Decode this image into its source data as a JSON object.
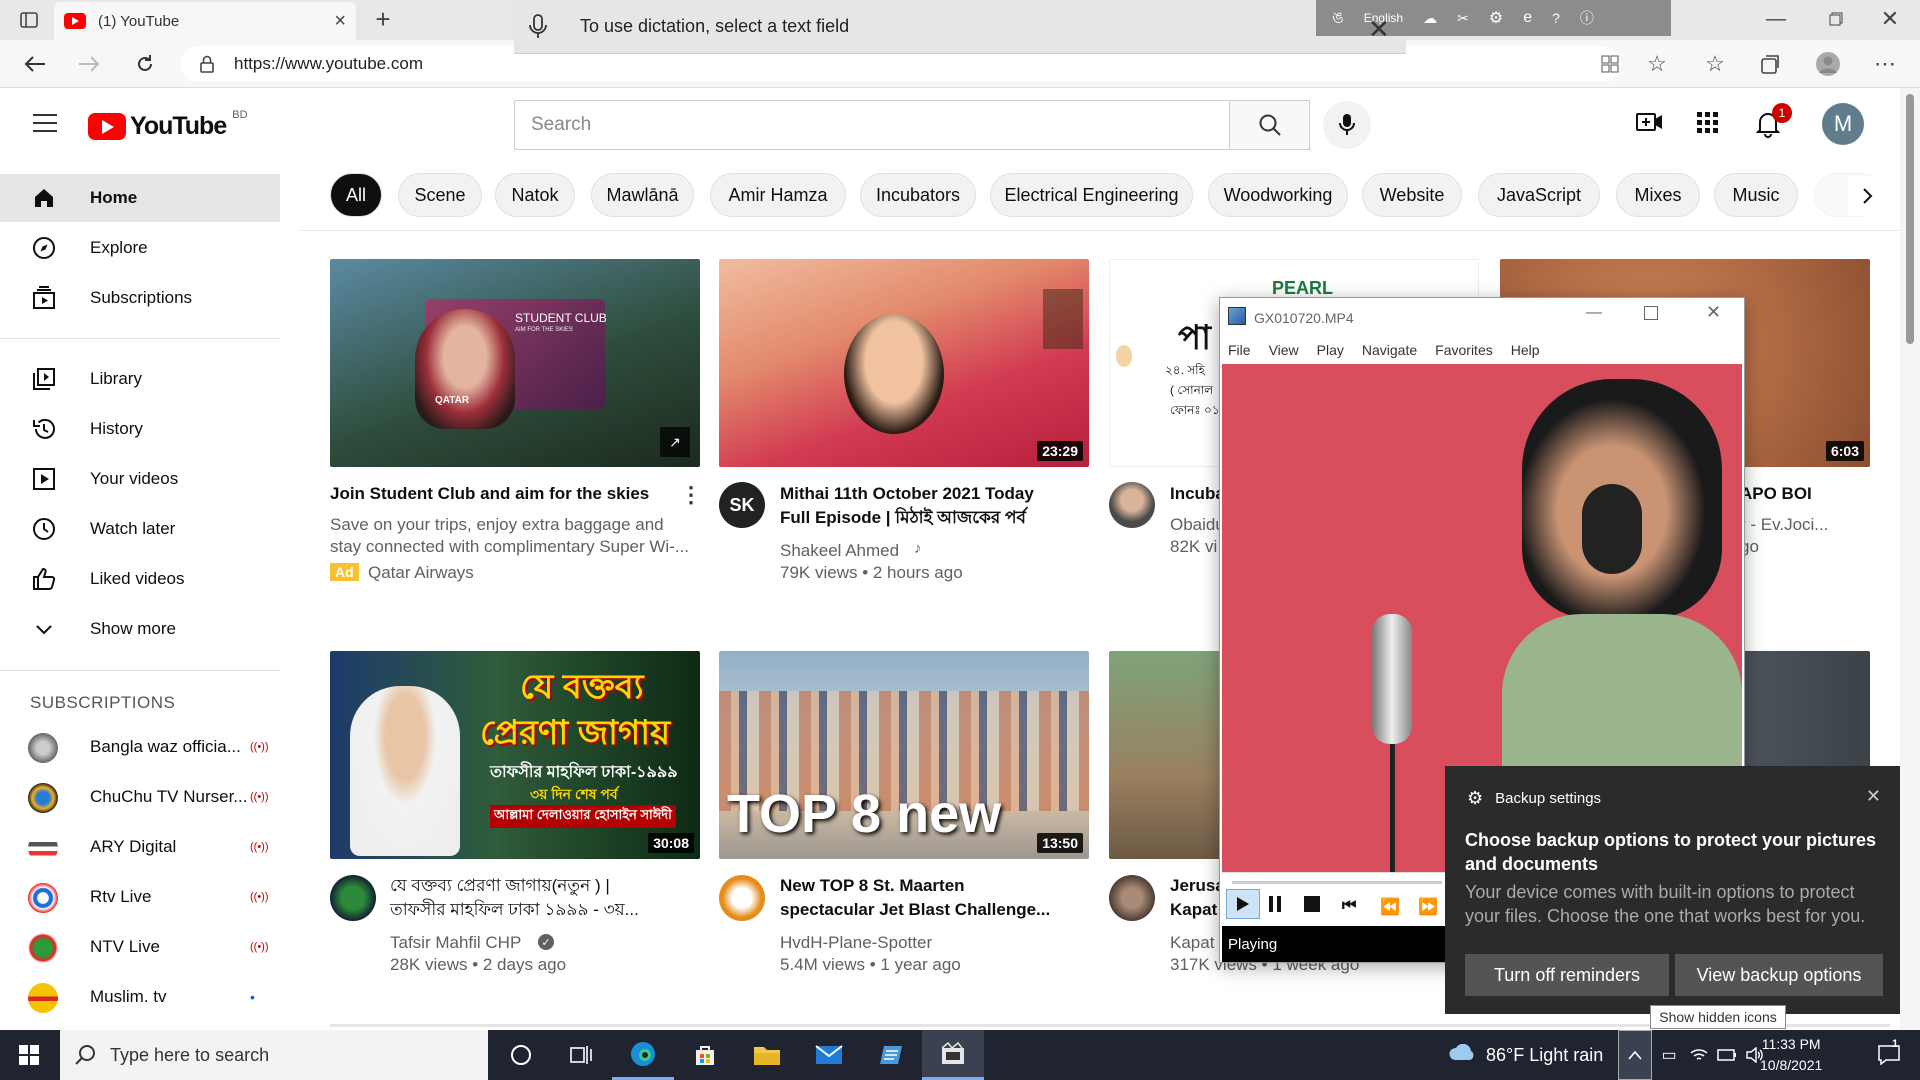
{
  "browser": {
    "tab_title": "(1) YouTube",
    "tab_close": "×",
    "new_tab": "+",
    "url": "https://www.youtube.com"
  },
  "dictation": {
    "text": "To use dictation, select a text field",
    "close": "✕"
  },
  "langbar": {
    "language": "English"
  },
  "youtube": {
    "logo_text": "YouTube",
    "country": "BD",
    "search_placeholder": "Search",
    "avatar_letter": "M",
    "notification_count": "1"
  },
  "sidebar": {
    "main": [
      {
        "label": "Home",
        "icon": "home-icon"
      },
      {
        "label": "Explore",
        "icon": "compass-icon"
      },
      {
        "label": "Subscriptions",
        "icon": "subscriptions-icon"
      }
    ],
    "library": [
      {
        "label": "Library",
        "icon": "library-icon"
      },
      {
        "label": "History",
        "icon": "history-icon"
      },
      {
        "label": "Your videos",
        "icon": "your-videos-icon"
      },
      {
        "label": "Watch later",
        "icon": "clock-icon"
      },
      {
        "label": "Liked videos",
        "icon": "thumb-up-icon"
      },
      {
        "label": "Show more",
        "icon": "chevron-down-icon"
      }
    ],
    "subscriptions_title": "SUBSCRIPTIONS",
    "subscriptions": [
      {
        "label": "Bangla waz officia...",
        "badge": "((•))"
      },
      {
        "label": "ChuChu TV Nurser...",
        "badge": "((•))"
      },
      {
        "label": "ARY Digital",
        "badge": "((•))"
      },
      {
        "label": "Rtv Live",
        "badge": "((•))"
      },
      {
        "label": "NTV Live",
        "badge": "((•))"
      },
      {
        "label": "Muslim. tv",
        "badge": "•"
      }
    ]
  },
  "chips": [
    "All",
    "Scene",
    "Natok",
    "Mawlānā",
    "Amir Hamza",
    "Incubators",
    "Electrical Engineering",
    "Woodworking",
    "Website",
    "JavaScript",
    "Mixes",
    "Music"
  ],
  "videos": [
    {
      "title": "Join Student Club and aim for the skies",
      "line2": "Save on your trips, enjoy extra baggage and",
      "line3": "stay connected with complimentary Super Wi-...",
      "channel": "Qatar Airways",
      "ad": "Ad",
      "thumb_text": "STUDENT CLUB",
      "thumb_sub": "AIM FOR THE SKIES",
      "thumb_brand": "QATAR"
    },
    {
      "title": "Mithai 11th October 2021 Today",
      "title2": "Full Episode | মিঠাই আজকের পর্ব",
      "channel": "Shakeel Ahmed",
      "stats": "79K views • 2 hours ago",
      "duration": "23:29",
      "avatar": "SK"
    },
    {
      "title": "Incuba",
      "channel": "Obaidu",
      "stats": "82K vi",
      "thumb_brand": "PEARL",
      "thumb_text": "পা",
      "thumb_l1": "২৪. সহি",
      "thumb_l2": "( সোনাল",
      "thumb_l3": "ফোনঃ ০১"
    },
    {
      "title": "APO BOI",
      "channel": "r - Ev.Joci...",
      "stats": "go",
      "duration": "6:03"
    },
    {
      "title": "যে বক্তব্য প্রেরণা জাগায়(নতুন ) |",
      "title2": "তাফসীর মাহফিল ঢাকা ১৯৯৯ - ৩য়...",
      "channel": "Tafsir Mahfil CHP",
      "stats": "28K views • 2 days ago",
      "duration": "30:08",
      "thumb_big": "যে বক্তব্য",
      "thumb_big2": "প্রেরণা জাগায়",
      "thumb_l1": "তাফসীর মাহফিল ঢাকা-১৯৯৯",
      "thumb_l2": "৩য় দিন শেষ পর্ব",
      "thumb_l3": "আল্লামা দেলাওয়ার হোসাইন সাঈদী"
    },
    {
      "title": "New TOP 8 St. Maarten",
      "title2": "spectacular Jet Blast Challenge...",
      "channel": "HvdH-Plane-Spotter",
      "stats": "5.4M views • 1 year ago",
      "duration": "13:50",
      "thumb_text": "TOP 8 new"
    },
    {
      "title": "Jerusa",
      "title2": "Kapat",
      "channel": "Kapat",
      "stats": "317K views • 1 week ago"
    }
  ],
  "player": {
    "title": "GX010720.MP4",
    "menu": [
      "File",
      "View",
      "Play",
      "Navigate",
      "Favorites",
      "Help"
    ],
    "status": "Playing"
  },
  "toast": {
    "header": "Backup settings",
    "heading": "Choose backup options to protect your pictures and documents",
    "body": "Your device comes with built-in options to protect your files. Choose the one that works best for you.",
    "btn_off": "Turn off reminders",
    "btn_view": "View backup options",
    "close": "✕"
  },
  "tooltip": "Show hidden icons",
  "taskbar": {
    "search_placeholder": "Type here to search",
    "weather": "86°F  Light rain",
    "time": "11:33 PM",
    "date": "10/8/2021",
    "notif_count": "1"
  },
  "colors": {
    "youtube_red": "#ff0000",
    "chip_active": "#0f0f0f",
    "taskbar": "#1f2430",
    "toast_bg": "#2b2b2b"
  }
}
